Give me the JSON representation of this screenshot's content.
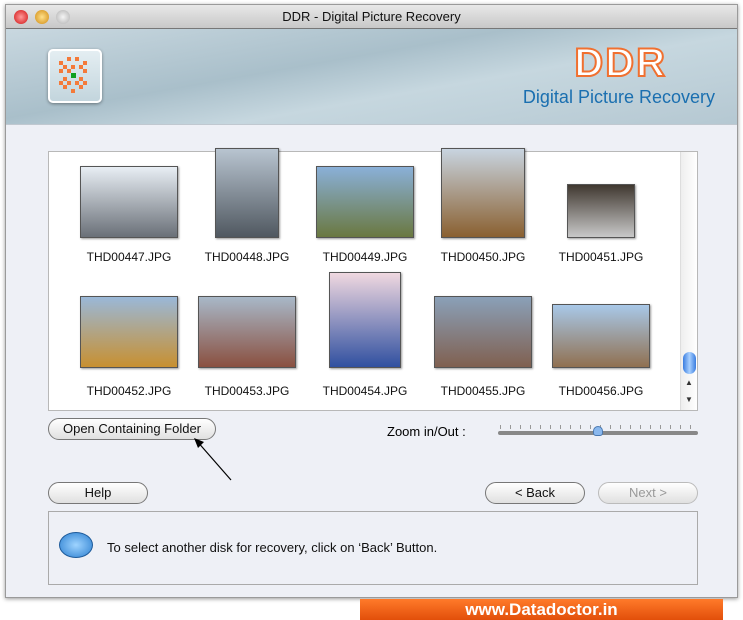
{
  "window": {
    "title": "DDR - Digital Picture Recovery"
  },
  "banner": {
    "brand": "DDR",
    "subtitle": "Digital Picture Recovery"
  },
  "gallery": {
    "items": [
      {
        "name": "THD00447.JPG",
        "colors": [
          "#e8eef4",
          "#6a7078"
        ]
      },
      {
        "name": "THD00448.JPG",
        "colors": [
          "#b8c4d0",
          "#505860"
        ]
      },
      {
        "name": "THD00449.JPG",
        "colors": [
          "#8ab0d8",
          "#6a7840"
        ]
      },
      {
        "name": "THD00450.JPG",
        "colors": [
          "#c8d4e0",
          "#8a6030"
        ]
      },
      {
        "name": "THD00451.JPG",
        "colors": [
          "#403830",
          "#c8c8c8"
        ]
      },
      {
        "name": "THD00452.JPG",
        "colors": [
          "#9ab8d8",
          "#c89030"
        ]
      },
      {
        "name": "THD00453.JPG",
        "colors": [
          "#a8b8c8",
          "#8a5040"
        ]
      },
      {
        "name": "THD00454.JPG",
        "colors": [
          "#f0d8e0",
          "#3050a0"
        ]
      },
      {
        "name": "THD00455.JPG",
        "colors": [
          "#8aa0b8",
          "#806050"
        ]
      },
      {
        "name": "THD00456.JPG",
        "colors": [
          "#a8c8e8",
          "#907050"
        ]
      }
    ]
  },
  "buttons": {
    "open_folder": "Open Containing Folder",
    "help": "Help",
    "back": "< Back",
    "next": "Next >"
  },
  "zoom": {
    "label": "Zoom in/Out :",
    "value_fraction": 0.5
  },
  "message": {
    "text": "To select another disk for recovery, click on ‘Back’ Button."
  },
  "footer": {
    "text": "www.Datadoctor.in"
  }
}
